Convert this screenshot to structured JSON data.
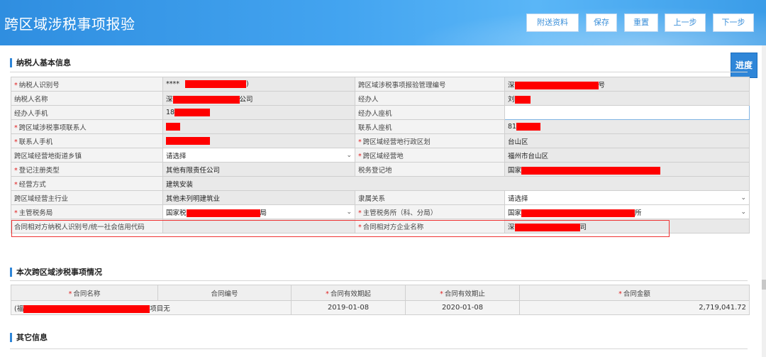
{
  "header": {
    "title": "跨区域涉税事项报验",
    "buttons": [
      "附送资料",
      "保存",
      "重置",
      "上一步",
      "下一步"
    ]
  },
  "progress_label": "进度",
  "sections": {
    "basic": "纳税人基本信息",
    "situation": "本次跨区域涉税事项情况",
    "other": "其它信息"
  },
  "form": {
    "taxpayer_id_label": "纳税人识别号",
    "taxpayer_id_value": "****",
    "taxpayer_id_suffix": ")",
    "report_no_label": "跨区域涉税事项报验管理编号",
    "report_no_prefix": "深",
    "report_no_suffix": "号",
    "taxpayer_name_label": "纳税人名称",
    "taxpayer_name_prefix": "深",
    "taxpayer_name_suffix": "公司",
    "handler_label": "经办人",
    "handler_prefix": "刘",
    "handler_phone_label": "经办人手机",
    "handler_phone_prefix": "18",
    "handler_landline_label": "经办人座机",
    "contact_label": "跨区域涉税事项联系人",
    "contact_landline_label": "联系人座机",
    "contact_landline_prefix": "81",
    "contact_phone_label": "联系人手机",
    "region_label": "跨区域经营地行政区划",
    "region_value": "台山区",
    "street_label": "跨区域经营地街道乡镇",
    "street_value": "请选择",
    "location_label": "跨区域经营地",
    "location_value": "福州市台山区",
    "reg_type_label": "登记注册类型",
    "reg_type_value": "其他有限责任公司",
    "tax_reg_place_label": "税务登记地",
    "tax_reg_place_prefix": "国家",
    "operation_mode_label": "经营方式",
    "operation_mode_value": "建筑安装",
    "industry_label": "跨区域经营主行业",
    "industry_value": "其他未列明建筑业",
    "affiliation_label": "隶属关系",
    "affiliation_value": "请选择",
    "tax_bureau_label": "主管税务局",
    "tax_bureau_prefix": "国家税",
    "tax_bureau_suffix": "局",
    "tax_office_label": "主管税务所（科、分局）",
    "tax_office_prefix": "国家",
    "tax_office_suffix": "所",
    "counterpart_id_label": "合同相对方纳税人识别号/统一社会信用代码",
    "counterpart_name_label": "合同相对方企业名称",
    "counterpart_name_prefix": "深",
    "counterpart_name_suffix": "司"
  },
  "contract": {
    "headers": [
      "合同名称",
      "合同编号",
      "合同有效期起",
      "合同有效期止",
      "合同金额"
    ],
    "row": {
      "name_prefix": "(福",
      "name_suffix": "项目",
      "number": "无",
      "start": "2019-01-08",
      "end": "2020-01-08",
      "amount": "2,719,041.72"
    }
  },
  "colors": {
    "header_blue": "#3a9ce8",
    "accent": "#2f86d8",
    "required": "#e02020",
    "redaction": "#ff0000",
    "highlight_border": "#e33333"
  }
}
